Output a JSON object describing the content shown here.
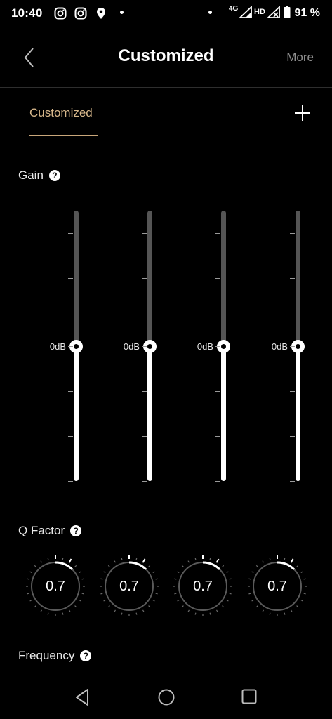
{
  "status_bar": {
    "time": "10:40",
    "network": "4G",
    "hd": "HD",
    "battery": "91 %"
  },
  "header": {
    "title": "Customized",
    "more_label": "More",
    "back_icon": "chevron-left-icon"
  },
  "tabs": [
    {
      "label": "Customized",
      "selected": true
    }
  ],
  "add_icon": "plus-icon",
  "gain": {
    "label": "Gain",
    "help_glyph": "?",
    "bands": [
      {
        "level_label": "0dB",
        "gain_db": 0
      },
      {
        "level_label": "0dB",
        "gain_db": 0
      },
      {
        "level_label": "0dB",
        "gain_db": 0
      },
      {
        "level_label": "0dB",
        "gain_db": 0
      }
    ]
  },
  "q_factor": {
    "label": "Q Factor",
    "help_glyph": "?",
    "knobs": [
      {
        "value": "0.7"
      },
      {
        "value": "0.7"
      },
      {
        "value": "0.7"
      },
      {
        "value": "0.7"
      }
    ]
  },
  "frequency": {
    "label": "Frequency",
    "help_glyph": "?"
  },
  "colors": {
    "background": "#000000",
    "accent": "#c8a67a",
    "muted_text": "#8e8e8e",
    "track": "#555555"
  }
}
